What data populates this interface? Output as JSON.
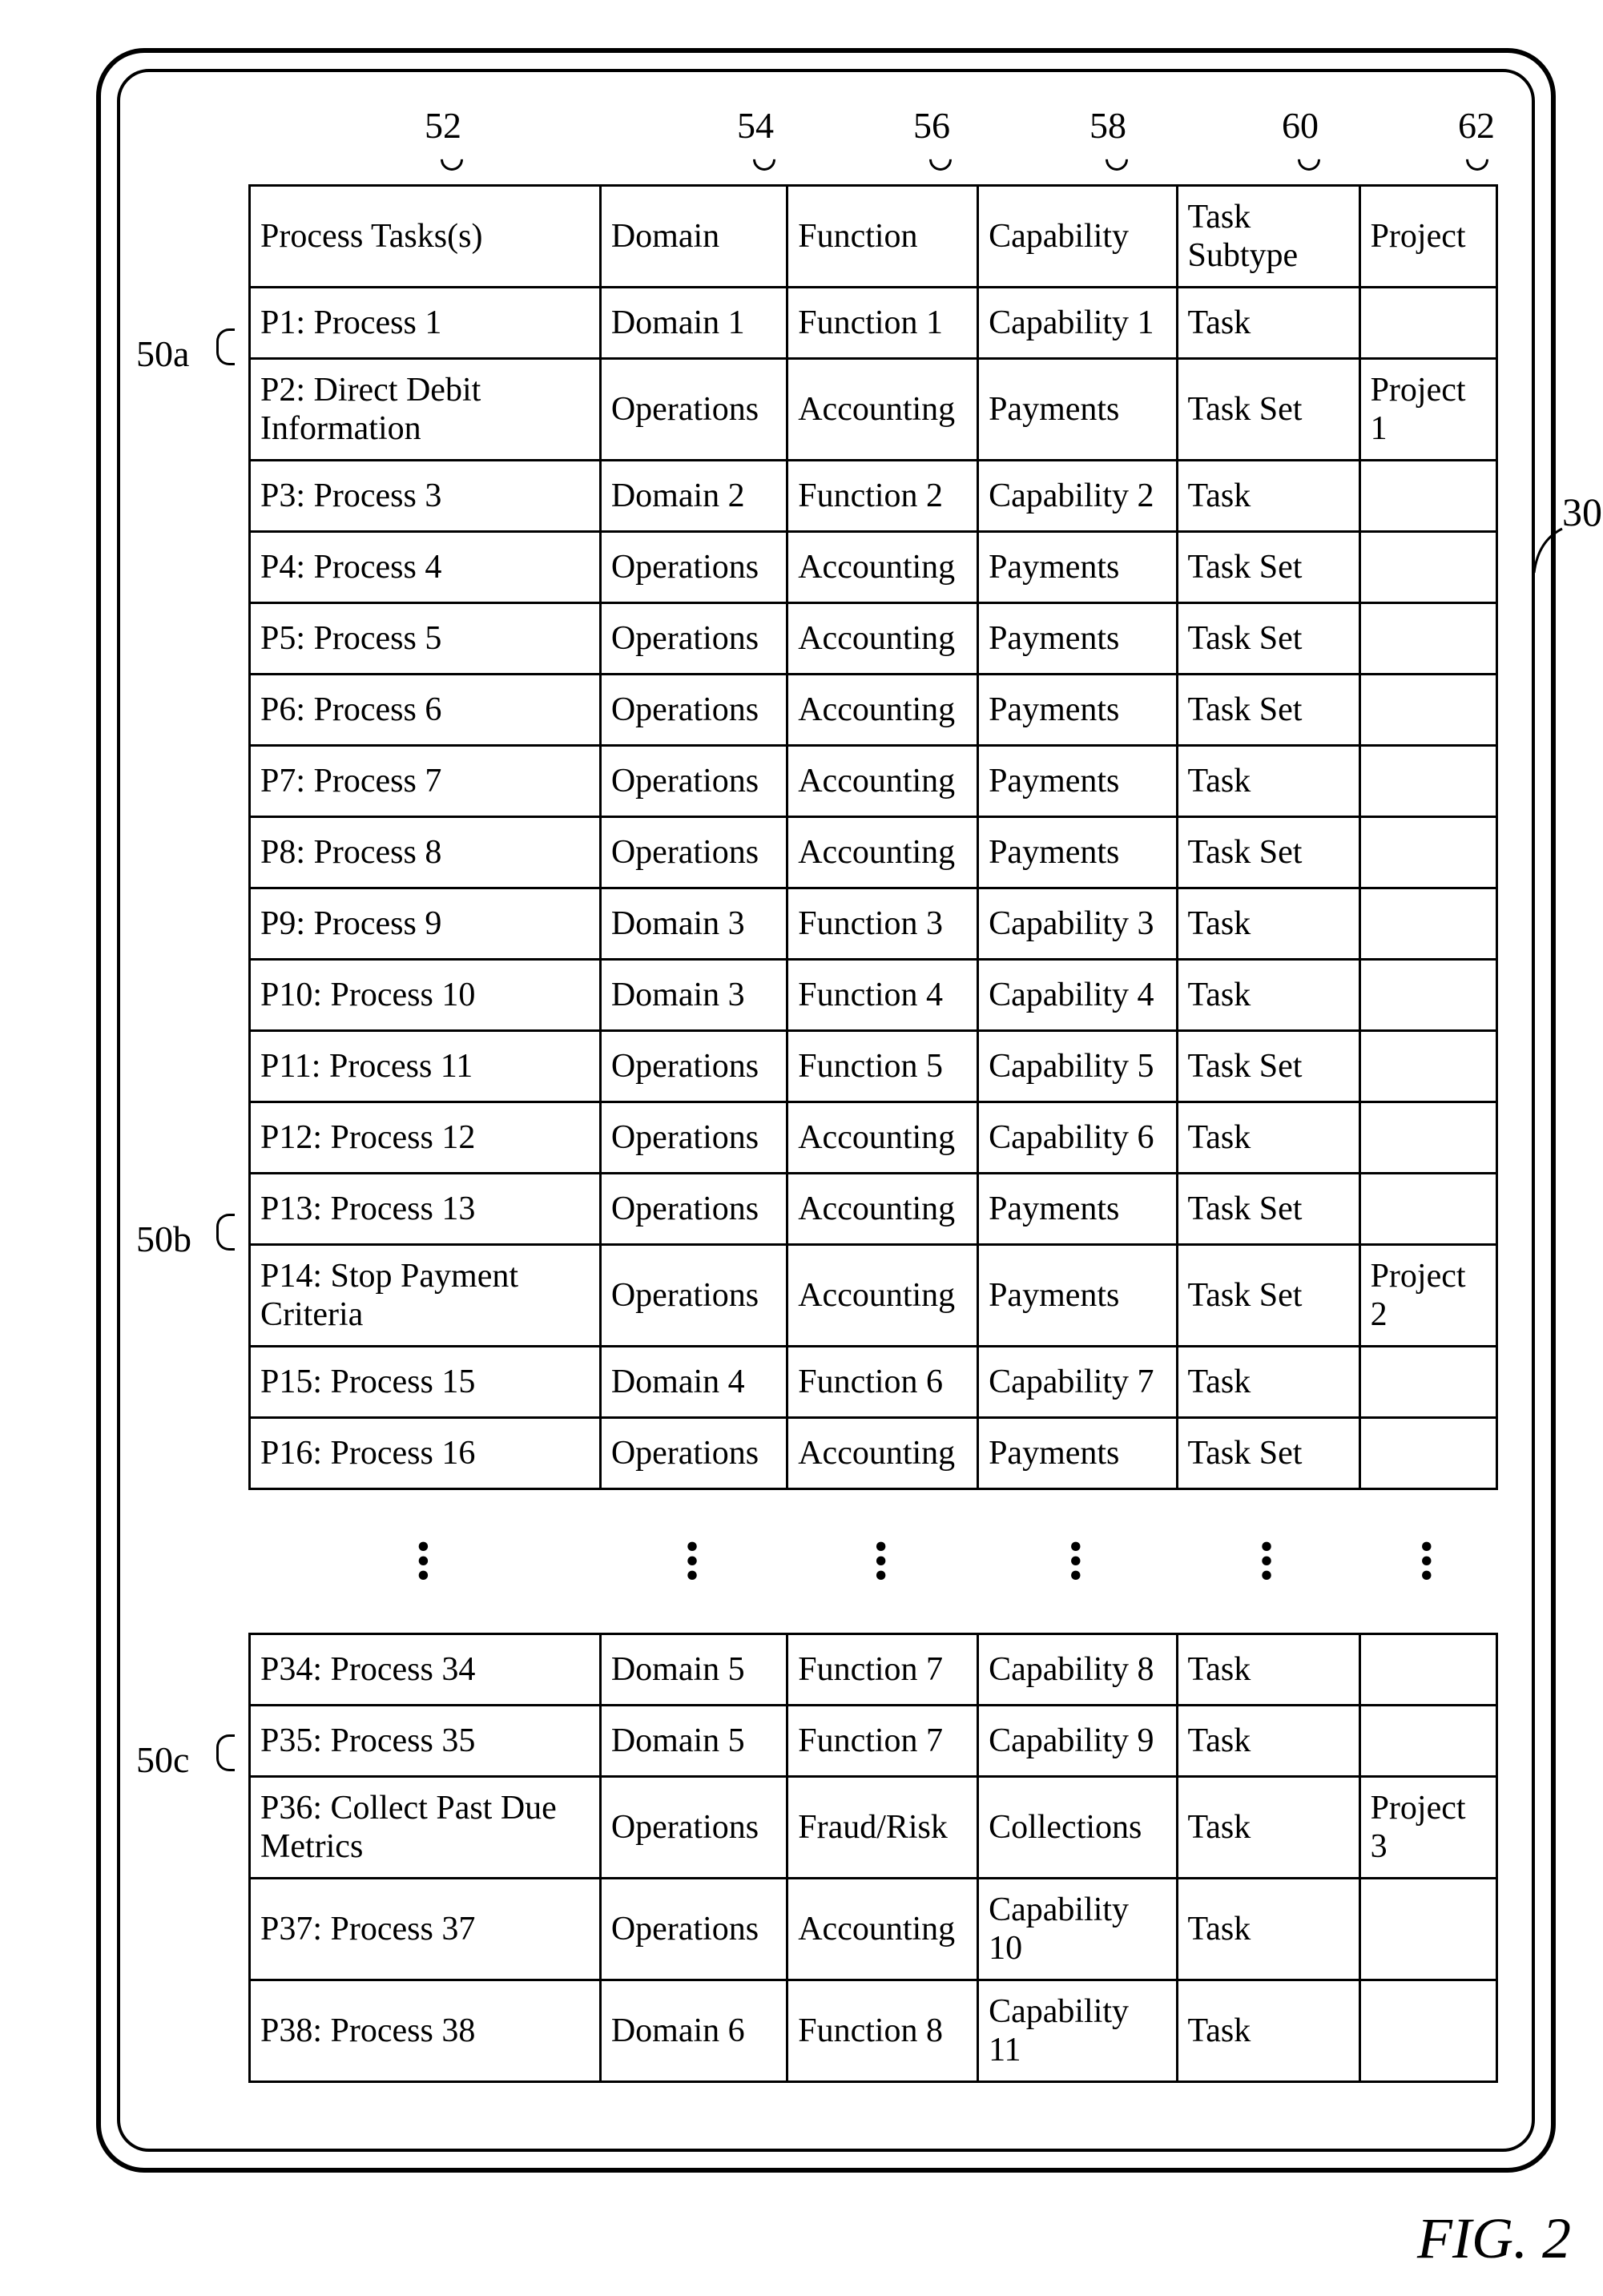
{
  "figure_label": "FIG. 2",
  "callouts": {
    "col_task": "52",
    "col_domain": "54",
    "col_function": "56",
    "col_capability": "58",
    "col_subtype": "60",
    "col_project": "62",
    "row_50a": "50a",
    "row_50b": "50b",
    "row_50c": "50c",
    "ref30": "30"
  },
  "columns": {
    "task": "Process Tasks(s)",
    "domain": "Domain",
    "function": "Function",
    "capability": "Capability",
    "subtype": "Task Subtype",
    "project": "Project"
  },
  "rows": [
    {
      "task": "P1: Process 1",
      "domain": "Domain 1",
      "function": "Function 1",
      "capability": "Capability 1",
      "subtype": "Task",
      "project": ""
    },
    {
      "task": "P2: Direct Debit Information",
      "domain": "Operations",
      "function": "Accounting",
      "capability": "Payments",
      "subtype": "Task Set",
      "project": "Project 1"
    },
    {
      "task": "P3: Process 3",
      "domain": "Domain 2",
      "function": "Function 2",
      "capability": "Capability 2",
      "subtype": "Task",
      "project": ""
    },
    {
      "task": "P4: Process 4",
      "domain": "Operations",
      "function": "Accounting",
      "capability": "Payments",
      "subtype": "Task Set",
      "project": ""
    },
    {
      "task": "P5: Process 5",
      "domain": "Operations",
      "function": "Accounting",
      "capability": "Payments",
      "subtype": "Task Set",
      "project": ""
    },
    {
      "task": "P6: Process 6",
      "domain": "Operations",
      "function": "Accounting",
      "capability": "Payments",
      "subtype": "Task Set",
      "project": ""
    },
    {
      "task": "P7: Process 7",
      "domain": "Operations",
      "function": "Accounting",
      "capability": "Payments",
      "subtype": "Task",
      "project": ""
    },
    {
      "task": "P8: Process 8",
      "domain": "Operations",
      "function": "Accounting",
      "capability": "Payments",
      "subtype": "Task Set",
      "project": ""
    },
    {
      "task": "P9: Process 9",
      "domain": "Domain 3",
      "function": "Function 3",
      "capability": "Capability 3",
      "subtype": "Task",
      "project": ""
    },
    {
      "task": "P10: Process 10",
      "domain": "Domain 3",
      "function": "Function 4",
      "capability": "Capability 4",
      "subtype": "Task",
      "project": ""
    },
    {
      "task": "P11: Process 11",
      "domain": "Operations",
      "function": "Function 5",
      "capability": "Capability 5",
      "subtype": "Task Set",
      "project": ""
    },
    {
      "task": "P12: Process 12",
      "domain": "Operations",
      "function": "Accounting",
      "capability": "Capability 6",
      "subtype": "Task",
      "project": ""
    },
    {
      "task": "P13: Process 13",
      "domain": "Operations",
      "function": "Accounting",
      "capability": "Payments",
      "subtype": "Task Set",
      "project": ""
    },
    {
      "task": "P14: Stop Payment Criteria",
      "domain": "Operations",
      "function": "Accounting",
      "capability": "Payments",
      "subtype": "Task Set",
      "project": "Project 2"
    },
    {
      "task": "P15: Process 15",
      "domain": "Domain 4",
      "function": "Function 6",
      "capability": "Capability 7",
      "subtype": "Task",
      "project": ""
    },
    {
      "task": "P16: Process 16",
      "domain": "Operations",
      "function": "Accounting",
      "capability": "Payments",
      "subtype": "Task Set",
      "project": ""
    },
    {
      "ellipsis": true
    },
    {
      "task": "P34: Process 34",
      "domain": "Domain 5",
      "function": "Function 7",
      "capability": "Capability 8",
      "subtype": "Task",
      "project": ""
    },
    {
      "task": "P35: Process 35",
      "domain": "Domain 5",
      "function": "Function 7",
      "capability": "Capability 9",
      "subtype": "Task",
      "project": ""
    },
    {
      "task": "P36: Collect Past Due Metrics",
      "domain": "Operations",
      "function": "Fraud/Risk",
      "capability": "Collections",
      "subtype": "Task",
      "project": "Project 3"
    },
    {
      "task": "P37: Process 37",
      "domain": "Operations",
      "function": "Accounting",
      "capability": "Capability 10",
      "subtype": "Task",
      "project": ""
    },
    {
      "task": "P38: Process 38",
      "domain": "Domain 6",
      "function": "Function 8",
      "capability": "Capability 11",
      "subtype": "Task",
      "project": ""
    }
  ]
}
